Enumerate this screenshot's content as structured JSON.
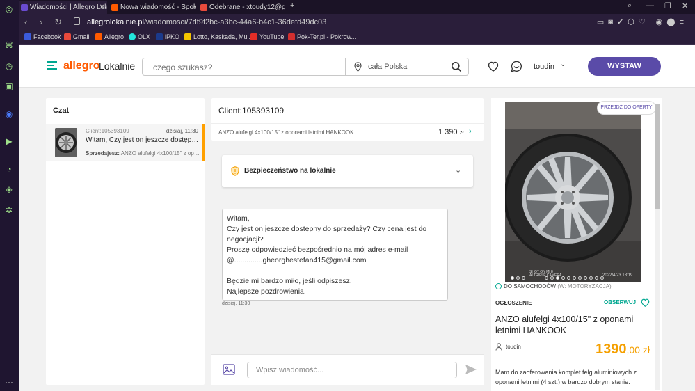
{
  "browser": {
    "tabs": [
      {
        "title": "Wiadomości | Allegro Lokal",
        "color": "#6a4bd0"
      },
      {
        "title": "Nowa wiadomość - Społec",
        "color": "#ff5a00"
      },
      {
        "title": "Odebrane - xtoudy12@gm",
        "color": "#e84a3c"
      }
    ],
    "new_tab": "+",
    "url_domain": "allegrolokalnie.pl",
    "url_path": "/wiadomosci/7df9f2bc-a3bc-44a6-b4c1-36defd49dc03",
    "bookmarks": [
      {
        "label": "Facebook",
        "color": "#3b5bdb"
      },
      {
        "label": "Gmail",
        "color": "#e84a3c"
      },
      {
        "label": "Allegro",
        "color": "#ff5a00"
      },
      {
        "label": "OLX",
        "color": "#23e5db"
      },
      {
        "label": "iPKO",
        "color": "#1b3a8c"
      },
      {
        "label": "Lotto, Kaskada, Mul...",
        "color": "#f5c400"
      },
      {
        "label": "YouTube",
        "color": "#e52d27"
      },
      {
        "label": "Pok-Ter.pl - Pokrow...",
        "color": "#d32f2f"
      }
    ]
  },
  "header": {
    "logo": "allegro",
    "logo_sub": "Lokalnie",
    "search_placeholder": "czego szukasz?",
    "location": "cała Polska",
    "username": "toudin",
    "cta": "WYSTAW"
  },
  "chat_list": {
    "title": "Czat",
    "items": [
      {
        "client": "Client:105393109",
        "date": "dzisiaj, 11:30",
        "message": "Witam, Czy jest on jeszcze dostępny do sprzedaży?",
        "seller_label": "Sprzedajesz:",
        "seller_item": "ANZO alufelgi 4x100/15\" z oponami letnimi HANKOOK"
      }
    ]
  },
  "chat": {
    "client_title": "Client:105393109",
    "offer_title": "ANZO alufelgi 4x100/15\" z oponami letnimi HANKOOK",
    "offer_price": "1 390",
    "offer_currency": "zł",
    "safety_title": "Bezpieczeństwo na lokalnie",
    "message_lines": [
      "Witam,",
      "Czy jest on jeszcze dostępny do sprzedaży? Czy cena jest do",
      "negocjacji?",
      "Proszę odpowiedzieć bezpośrednio na mój adres e-mail",
      "@..............gheorghestefan415@gmail.com",
      "",
      "Będzie mi bardzo miło, jeśli odpiszesz.",
      "Najlepsze pozdrowienia."
    ],
    "message_time": "dzisiaj, 11:30",
    "compose_placeholder": "Wpisz wiadomość..."
  },
  "product": {
    "go_to_offer": "PRZEJDŹ DO OFERTY",
    "photo_caption_1": "SHOT ON MI 8",
    "photo_caption_2": "AI TRIPLE CAMERA",
    "photo_date": "2022/4/23 18:19",
    "photo_count": 14,
    "photo_current": 5,
    "category": "DO SAMOCHODÓW",
    "category_sub": "(W: MOTORYZACJA)",
    "ad_label": "OGŁOSZENIE",
    "watch_label": "OBSERWUJ",
    "title": "ANZO alufelgi 4x100/15\" z oponami letnimi HANKOOK",
    "seller": "toudin",
    "price_main": "1390",
    "price_decimals": ",00 zł",
    "description": "Mam do zaoferowania komplet felg aluminiowych z oponami letnimi (4 szt.) w bardzo dobrym stanie."
  },
  "colors": {
    "accent_green": "#00a790",
    "cta_purple": "#5a4ba8",
    "price_orange": "#f5a000",
    "brand_orange": "#ff5a00"
  }
}
